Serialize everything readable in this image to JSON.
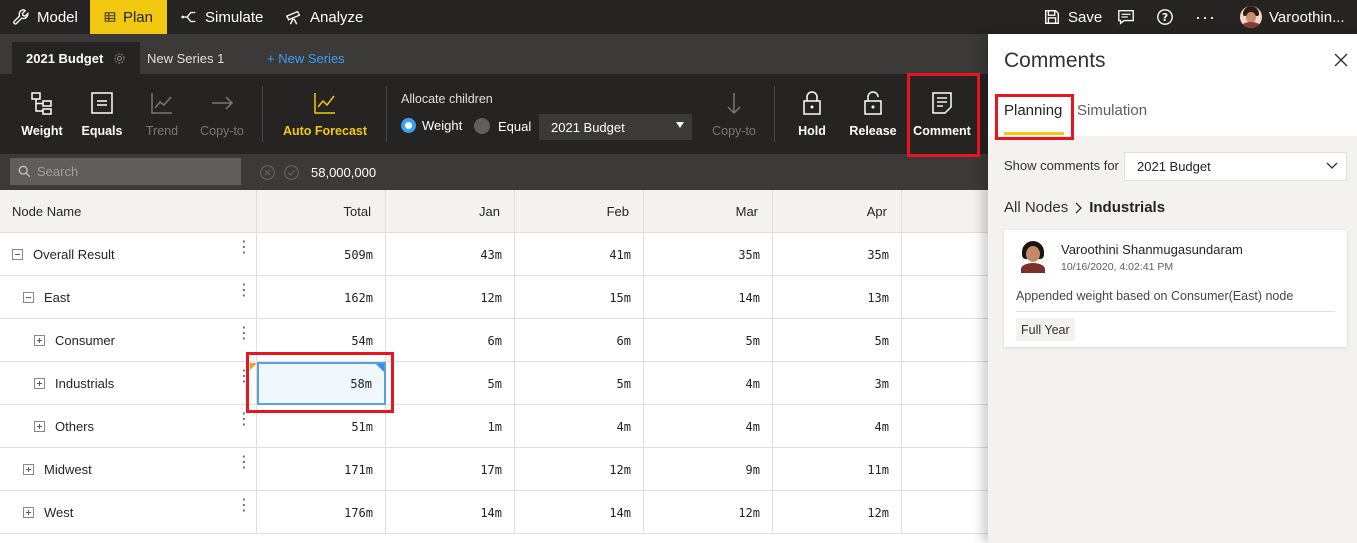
{
  "topbar": {
    "model": "Model",
    "plan": "Plan",
    "simulate": "Simulate",
    "analyze": "Analyze",
    "save": "Save",
    "user": "Varoothin..."
  },
  "series_tabs": {
    "active": "2021 Budget",
    "second": "New Series 1",
    "new": "+ New Series"
  },
  "ribbon": {
    "weight": "Weight",
    "equals": "Equals",
    "trend": "Trend",
    "copy_to": "Copy-to",
    "auto_forecast": "Auto Forecast",
    "allocate_label": "Allocate children",
    "opt_weight": "Weight",
    "opt_equal": "Equal",
    "series_select": "2021 Budget",
    "copy_to_2": "Copy-to",
    "hold": "Hold",
    "release": "Release",
    "comment": "Comment"
  },
  "search": {
    "placeholder": "Search",
    "value_display": "58,000,000"
  },
  "grid": {
    "headers": [
      "Node Name",
      "Total",
      "Jan",
      "Feb",
      "Mar",
      "Apr"
    ],
    "rows": [
      {
        "name": "Overall Result",
        "cells": [
          "509m",
          "43m",
          "41m",
          "35m",
          "35m"
        ]
      },
      {
        "name": "East",
        "cells": [
          "162m",
          "12m",
          "15m",
          "14m",
          "13m"
        ]
      },
      {
        "name": "Consumer",
        "cells": [
          "54m",
          "6m",
          "6m",
          "5m",
          "5m"
        ]
      },
      {
        "name": "Industrials",
        "cells": [
          "58m",
          "5m",
          "5m",
          "4m",
          "3m"
        ]
      },
      {
        "name": "Others",
        "cells": [
          "51m",
          "1m",
          "4m",
          "4m",
          "4m"
        ]
      },
      {
        "name": "Midwest",
        "cells": [
          "171m",
          "17m",
          "12m",
          "9m",
          "11m"
        ]
      },
      {
        "name": "West",
        "cells": [
          "176m",
          "14m",
          "14m",
          "12m",
          "12m"
        ]
      }
    ]
  },
  "panel": {
    "title": "Comments",
    "tab_planning": "Planning",
    "tab_simulation": "Simulation",
    "show_for_label": "Show comments for",
    "show_for_value": "2021 Budget",
    "crumb_all": "All Nodes",
    "crumb_current": "Industrials",
    "comment": {
      "author": "Varoothini Shanmugasundaram",
      "timestamp": "10/16/2020, 4:02:41 PM",
      "text": "Appended weight based on Consumer(East) node",
      "tag": "Full Year"
    }
  },
  "colors": {
    "accent": "#f2c811",
    "dark": "#252423",
    "highlight": "#e8141f",
    "selection": "#5aa0e0"
  }
}
